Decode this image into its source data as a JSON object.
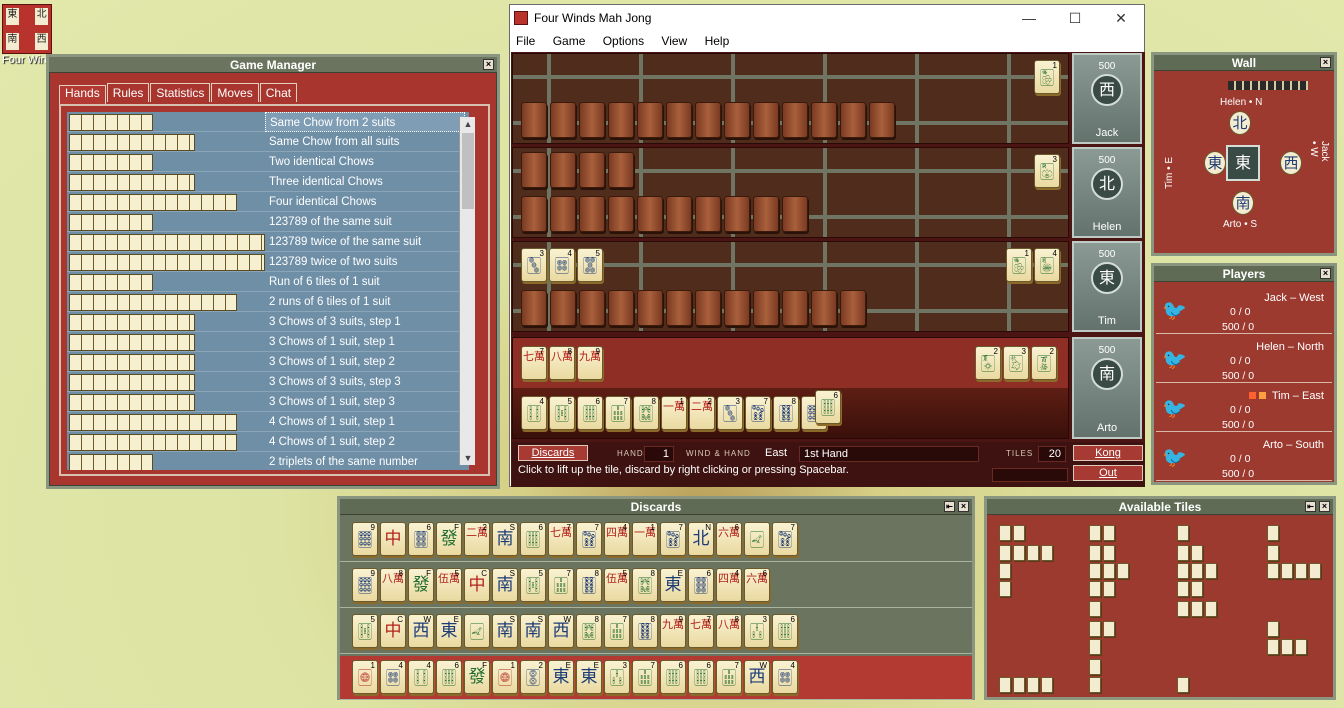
{
  "desktop": {
    "icon_label": "Four Winds Mah Jong",
    "icon_glyphs": [
      "東",
      "北",
      "南",
      "西"
    ]
  },
  "game_manager": {
    "title": "Game Manager",
    "tabs": [
      "Hands",
      "Rules",
      "Statistics",
      "Moves",
      "Chat"
    ],
    "hands": [
      {
        "name": "Same Chow from 2 suits",
        "w": 84
      },
      {
        "name": "Same Chow from all suits",
        "w": 126
      },
      {
        "name": "Two identical Chows",
        "w": 84
      },
      {
        "name": "Three identical Chows",
        "w": 126
      },
      {
        "name": "Four identical Chows",
        "w": 168
      },
      {
        "name": "123789 of the same suit",
        "w": 84
      },
      {
        "name": "123789 twice of the same suit",
        "w": 196
      },
      {
        "name": "123789 twice of two suits",
        "w": 196
      },
      {
        "name": "Run of 6 tiles of 1 suit",
        "w": 84
      },
      {
        "name": "2 runs of 6 tiles of 1 suit",
        "w": 168
      },
      {
        "name": "3 Chows of 3 suits, step 1",
        "w": 126
      },
      {
        "name": "3 Chows of 1 suit, step 1",
        "w": 126
      },
      {
        "name": "3 Chows of 1 suit, step 2",
        "w": 126
      },
      {
        "name": "3 Chows of 3 suits, step 3",
        "w": 126
      },
      {
        "name": "3 Chows of 1 suit, step 3",
        "w": 126
      },
      {
        "name": "4 Chows of 1 suit, step 1",
        "w": 168
      },
      {
        "name": "4 Chows of 1 suit, step 2",
        "w": 168
      },
      {
        "name": "2 triplets of the same number",
        "w": 84
      }
    ]
  },
  "window": {
    "title": "Four Winds Mah Jong",
    "menu": [
      "File",
      "Game",
      "Options",
      "View",
      "Help"
    ],
    "seats": [
      {
        "score": "500",
        "wind": "西",
        "wind_letter": "W",
        "name": "Jack",
        "backs": 13,
        "exposed": [
          {
            "g": "🀢",
            "n": "1",
            "c": "t-grn"
          }
        ],
        "melds": []
      },
      {
        "score": "500",
        "wind": "北",
        "wind_letter": "N",
        "name": "Helen",
        "backs": 10,
        "top_backs": 4,
        "exposed": [
          {
            "g": "🀣",
            "n": "3",
            "c": "t-grn"
          }
        ],
        "melds": []
      },
      {
        "score": "500",
        "wind": "東",
        "wind_letter": "E",
        "name": "Tim",
        "backs": 12,
        "exposed": [
          {
            "g": "🀢",
            "n": "1",
            "c": "t-grn"
          },
          {
            "g": "🀥",
            "n": "4",
            "c": "t-grn"
          }
        ],
        "melds": [
          {
            "g": "🀛",
            "n": "3",
            "c": "t-blu"
          },
          {
            "g": "🀜",
            "n": "4",
            "c": "t-blu"
          },
          {
            "g": "🀝",
            "n": "5",
            "c": "t-blu"
          }
        ]
      },
      {
        "score": "500",
        "wind": "南",
        "wind_letter": "S",
        "name": "Arto"
      }
    ],
    "arto_meld": [
      {
        "g": "七萬",
        "n": "7",
        "c": "t-red"
      },
      {
        "g": "八萬",
        "n": "8",
        "c": "t-red"
      },
      {
        "g": "九萬",
        "n": "9",
        "c": "t-red"
      }
    ],
    "arto_flowers": [
      {
        "g": "🀧",
        "n": "2",
        "c": "t-grn"
      },
      {
        "g": "🀨",
        "n": "3",
        "c": "t-grn"
      },
      {
        "g": "🀪",
        "n": "2",
        "c": "t-grn"
      }
    ],
    "arto_hand": [
      {
        "g": "🀓",
        "n": "4",
        "c": "t-grn"
      },
      {
        "g": "🀔",
        "n": "5",
        "c": "t-grn"
      },
      {
        "g": "🀕",
        "n": "6",
        "c": "t-grn"
      },
      {
        "g": "🀖",
        "n": "7",
        "c": "t-grn"
      },
      {
        "g": "🀗",
        "n": "8",
        "c": "t-grn"
      },
      {
        "g": "一萬",
        "n": "1",
        "c": "t-red"
      },
      {
        "g": "二萬",
        "n": "2",
        "c": "t-red"
      },
      {
        "g": "🀛",
        "n": "3",
        "c": "t-blu"
      },
      {
        "g": "🀟",
        "n": "7",
        "c": "t-blu"
      },
      {
        "g": "🀠",
        "n": "8",
        "c": "t-blu"
      },
      {
        "g": "🀡",
        "n": "9",
        "c": "t-blu"
      },
      {
        "g": "🀕",
        "n": "6",
        "c": "t-grn"
      }
    ],
    "status": {
      "discards_btn": "Discards",
      "hand_label": "HAND#",
      "hand_no": "1",
      "wind_label": "WIND & HAND",
      "wind_val": "East",
      "hand_val": "1st Hand",
      "tiles_label": "TILES",
      "tiles_val": "20",
      "kong_btn": "Kong",
      "out_btn": "Out",
      "hint": "Click to lift up the tile, discard by right clicking or pressing Spacebar."
    }
  },
  "wall": {
    "title": "Wall",
    "north": "Helen • N",
    "south": "Arto • S",
    "east": "Tim • E",
    "west": "Jack • W",
    "center": "東",
    "n": "北",
    "s": "南",
    "e": "東",
    "w": "西"
  },
  "players": {
    "title": "Players",
    "rows": [
      {
        "name": "Jack – West",
        "s1": "0 / 0",
        "s2": "500 / 0"
      },
      {
        "name": "Helen – North",
        "s1": "0 / 0",
        "s2": "500 / 0"
      },
      {
        "name": "Tim – East",
        "s1": "0 / 0",
        "s2": "500 / 0"
      },
      {
        "name": "Arto – South",
        "s1": "0 / 0",
        "s2": "500 / 0"
      }
    ]
  },
  "discards": {
    "title": "Discards",
    "rows": [
      [
        {
          "g": "🀡",
          "n": "9",
          "c": "t-blu"
        },
        {
          "g": "中",
          "c": "t-red"
        },
        {
          "g": "🀞",
          "n": "6",
          "c": "t-blu"
        },
        {
          "g": "發",
          "n": "F",
          "c": "t-grn"
        },
        {
          "g": "二萬",
          "n": "2",
          "c": "t-red"
        },
        {
          "g": "南",
          "n": "S",
          "c": "t-blu"
        },
        {
          "g": "🀕",
          "n": "6",
          "c": "t-grn"
        },
        {
          "g": "七萬",
          "n": "7",
          "c": "t-red"
        },
        {
          "g": "🀟",
          "n": "7",
          "c": "t-blu"
        },
        {
          "g": "四萬",
          "n": "4",
          "c": "t-red"
        },
        {
          "g": "一萬",
          "n": "1",
          "c": "t-red"
        },
        {
          "g": "🀟",
          "n": "7",
          "c": "t-blu"
        },
        {
          "g": "北",
          "n": "N",
          "c": "t-blu"
        },
        {
          "g": "六萬",
          "n": "6",
          "c": "t-red"
        },
        {
          "g": "🀐",
          "c": "t-grn"
        },
        {
          "g": "🀟",
          "n": "7",
          "c": "t-blu"
        }
      ],
      [
        {
          "g": "🀡",
          "n": "9",
          "c": "t-blu"
        },
        {
          "g": "八萬",
          "n": "8",
          "c": "t-red"
        },
        {
          "g": "發",
          "n": "F",
          "c": "t-grn"
        },
        {
          "g": "伍萬",
          "n": "5",
          "c": "t-red"
        },
        {
          "g": "中",
          "n": "C",
          "c": "t-red"
        },
        {
          "g": "南",
          "n": "S",
          "c": "t-blu"
        },
        {
          "g": "🀔",
          "n": "5",
          "c": "t-grn"
        },
        {
          "g": "🀖",
          "n": "7",
          "c": "t-grn"
        },
        {
          "g": "🀠",
          "n": "8",
          "c": "t-blu"
        },
        {
          "g": "伍萬",
          "n": "5",
          "c": "t-red"
        },
        {
          "g": "🀗",
          "n": "8",
          "c": "t-grn"
        },
        {
          "g": "東",
          "n": "E",
          "c": "t-blu"
        },
        {
          "g": "🀞",
          "n": "6",
          "c": "t-blu"
        },
        {
          "g": "四萬",
          "n": "4",
          "c": "t-red"
        },
        {
          "g": "六萬",
          "n": "6",
          "c": "t-red"
        }
      ],
      [
        {
          "g": "🀔",
          "n": "5",
          "c": "t-grn"
        },
        {
          "g": "中",
          "n": "C",
          "c": "t-red"
        },
        {
          "g": "西",
          "n": "W",
          "c": "t-blu"
        },
        {
          "g": "東",
          "n": "E",
          "c": "t-blu"
        },
        {
          "g": "🀐",
          "c": "t-grn"
        },
        {
          "g": "南",
          "n": "S",
          "c": "t-blu"
        },
        {
          "g": "南",
          "n": "S",
          "c": "t-blu"
        },
        {
          "g": "西",
          "n": "W",
          "c": "t-blu"
        },
        {
          "g": "🀗",
          "n": "8",
          "c": "t-grn"
        },
        {
          "g": "🀖",
          "n": "7",
          "c": "t-grn"
        },
        {
          "g": "🀠",
          "n": "8",
          "c": "t-blu"
        },
        {
          "g": "九萬",
          "n": "9",
          "c": "t-red"
        },
        {
          "g": "七萬",
          "n": "7",
          "c": "t-red"
        },
        {
          "g": "八萬",
          "n": "8",
          "c": "t-red"
        },
        {
          "g": "🀒",
          "n": "3",
          "c": "t-grn"
        },
        {
          "g": "🀕",
          "n": "6",
          "c": "t-grn"
        }
      ],
      [
        {
          "g": "🀙",
          "n": "1",
          "c": "t-red"
        },
        {
          "g": "🀜",
          "n": "4",
          "c": "t-blu"
        },
        {
          "g": "🀓",
          "n": "4",
          "c": "t-grn"
        },
        {
          "g": "🀕",
          "n": "6",
          "c": "t-grn"
        },
        {
          "g": "發",
          "n": "F",
          "c": "t-grn"
        },
        {
          "g": "🀙",
          "n": "1",
          "c": "t-red"
        },
        {
          "g": "🀚",
          "n": "2",
          "c": "t-blu"
        },
        {
          "g": "東",
          "n": "E",
          "c": "t-blu"
        },
        {
          "g": "東",
          "n": "E",
          "c": "t-blu"
        },
        {
          "g": "🀒",
          "n": "3",
          "c": "t-grn"
        },
        {
          "g": "🀖",
          "n": "7",
          "c": "t-grn"
        },
        {
          "g": "🀕",
          "n": "6",
          "c": "t-grn"
        },
        {
          "g": "🀕",
          "n": "6",
          "c": "t-grn"
        },
        {
          "g": "🀖",
          "n": "7",
          "c": "t-grn"
        },
        {
          "g": "西",
          "n": "W",
          "c": "t-blu"
        },
        {
          "g": "🀜",
          "n": "4",
          "c": "t-blu"
        }
      ]
    ]
  },
  "available": {
    "title": "Available Tiles"
  }
}
